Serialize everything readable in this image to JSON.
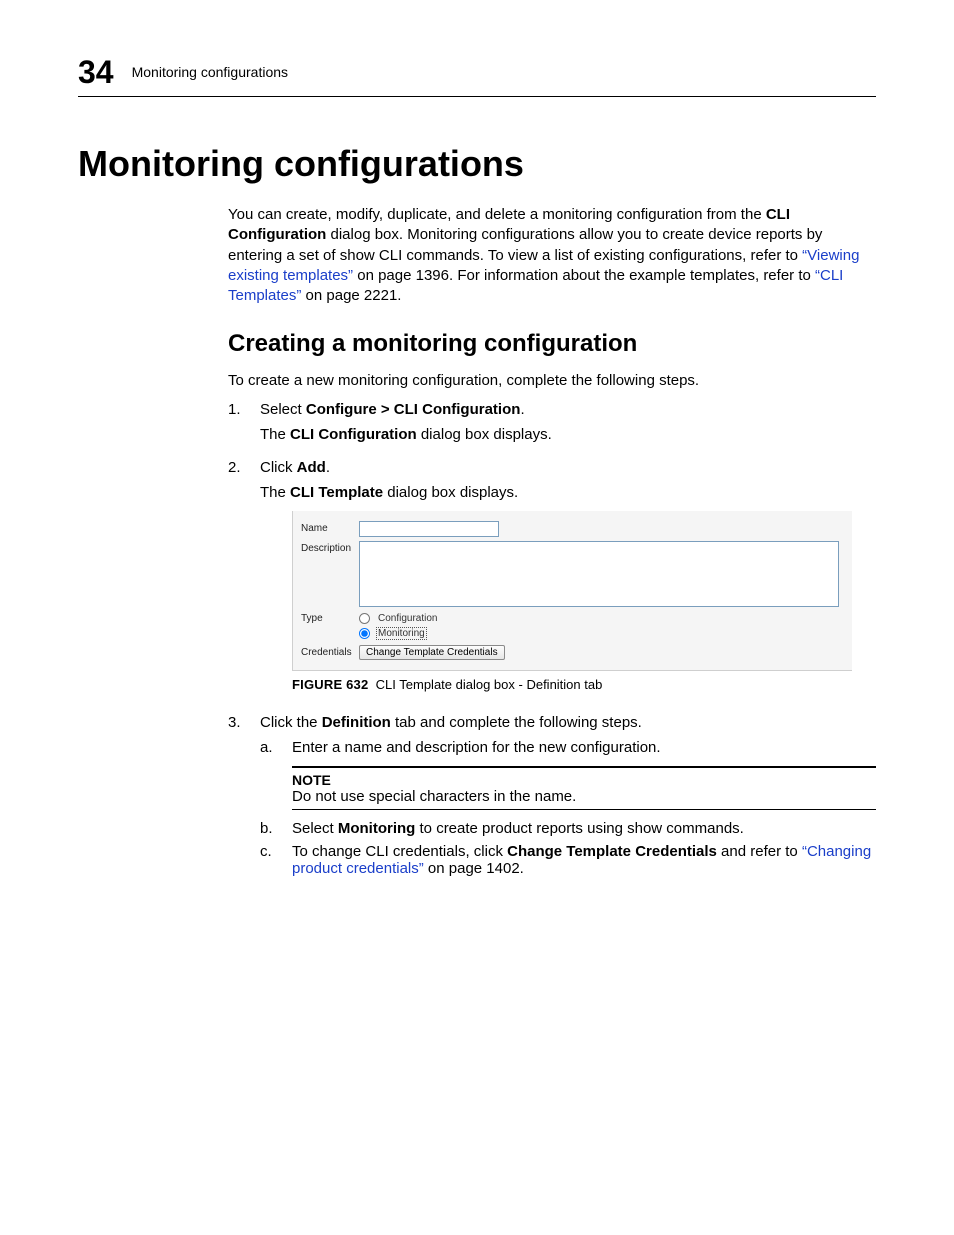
{
  "header": {
    "chapter_number": "34",
    "chapter_text": "Monitoring configurations"
  },
  "h1": "Monitoring configurations",
  "intro": {
    "p1a": "You can create, modify, duplicate, and delete a monitoring configuration from the ",
    "p1b_bold": "CLI Configuration",
    "p1c": " dialog box. Monitoring configurations allow you to create device reports by entering a set of show CLI commands. To view a list of existing configurations, refer to ",
    "link1": "“Viewing existing templates”",
    "p1d": " on page 1396. For information about the example templates, refer to ",
    "link2": "“CLI Templates”",
    "p1e": " on page 2221."
  },
  "h2": "Creating a monitoring configuration",
  "lead": "To create a new monitoring configuration, complete the following steps.",
  "steps": {
    "s1_num": "1.",
    "s1_a": "Select ",
    "s1_bold": "Configure > CLI Configuration",
    "s1_c": ".",
    "s1_follow_a": "The ",
    "s1_follow_bold": "CLI Configuration",
    "s1_follow_c": " dialog box displays.",
    "s2_num": "2.",
    "s2_a": "Click ",
    "s2_bold": "Add",
    "s2_c": ".",
    "s2_follow_a": "The ",
    "s2_follow_bold": "CLI Template",
    "s2_follow_c": " dialog box displays.",
    "fig_num": "FIGURE 632",
    "fig_cap": "CLI Template dialog box - Definition tab",
    "s3_num": "3.",
    "s3_a": "Click the ",
    "s3_bold": "Definition",
    "s3_c": " tab and complete the following steps.",
    "s3a_letter": "a.",
    "s3a_txt": "Enter a name and description for the new configuration.",
    "note_title": "NOTE",
    "note_body": "Do not use special characters in the name.",
    "s3b_letter": "b.",
    "s3b_a": "Select ",
    "s3b_bold": "Monitoring",
    "s3b_c": " to create product reports using show commands.",
    "s3c_letter": "c.",
    "s3c_a": "To change CLI credentials, click ",
    "s3c_bold": "Change Template Credentials",
    "s3c_c": " and refer to ",
    "s3c_link": "“Changing product credentials”",
    "s3c_d": " on page 1402."
  },
  "dialog": {
    "label_name": "Name",
    "label_desc": "Description",
    "label_type": "Type",
    "radio_cfg": "Configuration",
    "radio_mon": "Monitoring",
    "label_cred": "Credentials",
    "btn_cred": "Change Template Credentials",
    "name_value": "",
    "desc_value": ""
  }
}
